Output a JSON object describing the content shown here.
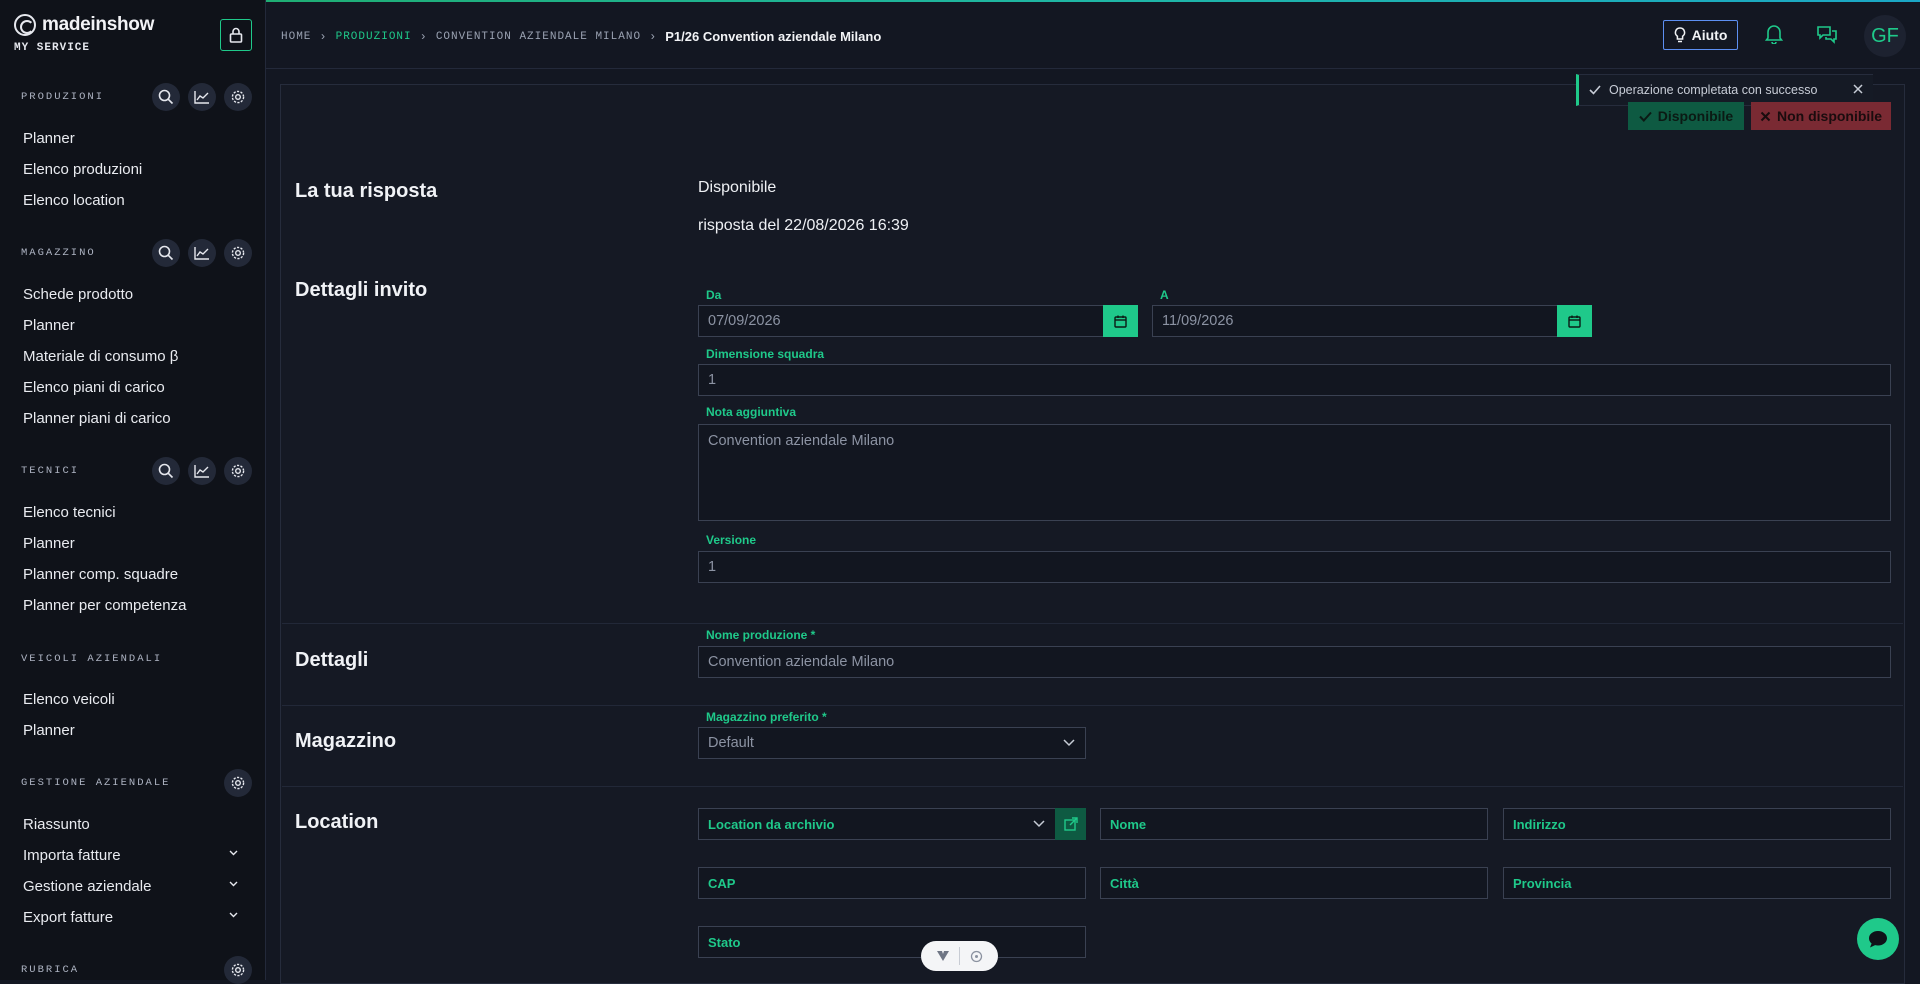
{
  "brand": {
    "name": "madeinshow",
    "subtitle": "MY SERVICE"
  },
  "sidebar": {
    "sections": [
      {
        "title": "PRODUZIONI",
        "items": [
          "Planner",
          "Elenco produzioni",
          "Elenco location"
        ]
      },
      {
        "title": "MAGAZZINO",
        "items": [
          "Schede prodotto",
          "Planner",
          "Materiale di consumo β",
          "Elenco piani di carico",
          "Planner piani di carico"
        ]
      },
      {
        "title": "TECNICI",
        "items": [
          "Elenco tecnici",
          "Planner",
          "Planner comp. squadre",
          "Planner per competenza"
        ]
      },
      {
        "title": "VEICOLI AZIENDALI",
        "items": [
          "Elenco veicoli",
          "Planner"
        ]
      },
      {
        "title": "GESTIONE AZIENDALE",
        "items": [
          "Riassunto",
          "Importa fatture",
          "Gestione aziendale",
          "Export fatture"
        ]
      },
      {
        "title": "RUBRICA",
        "items": []
      }
    ]
  },
  "breadcrumb": {
    "home": "HOME",
    "produzioni": "PRODUZIONI",
    "convention": "CONVENTION AZIENDALE MILANO",
    "current": "P1/26 Convention aziendale Milano"
  },
  "header": {
    "help_label": "Aiuto",
    "avatar_initials": "GF"
  },
  "toast": {
    "message": "Operazione completata con successo"
  },
  "actions": {
    "available": "Disponibile",
    "not_available": "Non disponibile"
  },
  "response": {
    "section_title": "La tua risposta",
    "value": "Disponibile",
    "answered_at": "risposta del 22/08/2026 16:39"
  },
  "invite": {
    "section_title": "Dettagli invito",
    "from_label": "Da",
    "from_value": "07/09/2026",
    "to_label": "A",
    "to_value": "11/09/2026",
    "team_label": "Dimensione squadra",
    "team_value": "1",
    "note_label": "Nota aggiuntiva",
    "note_value": "Convention aziendale Milano",
    "version_label": "Versione",
    "version_value": "1"
  },
  "details": {
    "section_title": "Dettagli",
    "name_label": "Nome produzione *",
    "name_value": "Convention aziendale Milano"
  },
  "warehouse": {
    "section_title": "Magazzino",
    "label": "Magazzino preferito *",
    "value": "Default"
  },
  "location": {
    "section_title": "Location",
    "archive": "Location da archivio",
    "name": "Nome",
    "address": "Indirizzo",
    "zip": "CAP",
    "city": "Città",
    "province": "Provincia",
    "state": "Stato"
  }
}
